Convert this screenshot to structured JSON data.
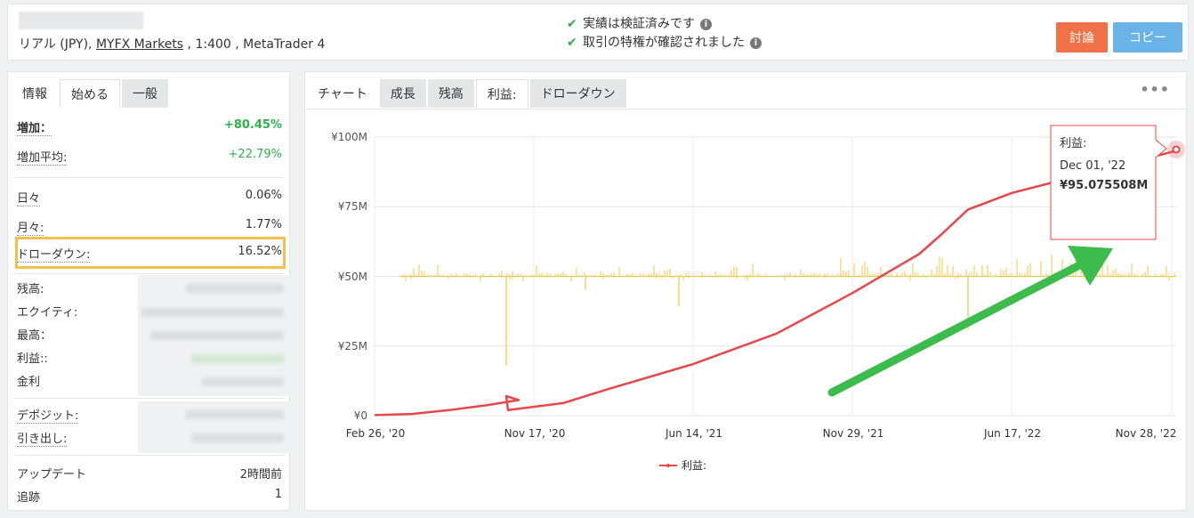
{
  "header": {
    "account_line_prefix": "リアル (JPY), ",
    "broker": "MYFX Markets",
    "account_line_suffix": " , 1:400 , MetaTrader 4",
    "verify1": "実績は検証済みです",
    "verify2": "取引の特権が確認されました",
    "discuss_label": "討論",
    "copy_label": "コピー"
  },
  "left_tabs": [
    "情報",
    "始める",
    "一般"
  ],
  "stats": {
    "gain_label": "増加：",
    "gain_value": "+80.45%",
    "avg_gain_label": "増加平均:",
    "avg_gain_value": "+22.79%",
    "daily_label": "日々",
    "daily_value": "0.06%",
    "monthly_label": "月々:",
    "monthly_value": "1.77%",
    "drawdown_label": "ドローダウン:",
    "drawdown_value": "16.52%",
    "balance_label": "残高:",
    "equity_label": "エクイティ:",
    "highest_label": "最高：",
    "profit_label": "利益::",
    "interest_label": "金利",
    "deposits_label": "デポジット:",
    "withdrawals_label": "引き出し:",
    "updated_label": "アップデート",
    "updated_value": "2時間前",
    "tracking_label": "追跡",
    "tracking_value": "1"
  },
  "right_tabs": [
    "チャート",
    "成長",
    "残高",
    "利益:",
    "ドローダウン"
  ],
  "more_label": "•••",
  "tooltip": {
    "title": "利益:",
    "date": "Dec 01, '22",
    "value": "¥95.075508M"
  },
  "colors": {
    "profit_line": "#e8474a",
    "volume_bars": "#f4c542",
    "arrow": "#3cbc4d",
    "highlight": "#f2c04f"
  },
  "chart_data": {
    "type": "line",
    "y_ticks": [
      "¥100M",
      "¥75M",
      "¥50M",
      "¥25M",
      "¥0"
    ],
    "x_ticks": [
      "Feb 26, '20",
      "Nov 17, '20",
      "Jun 14, '21",
      "Nov 29, '21",
      "Jun 17, '22",
      "Nov 28, '22"
    ],
    "ylim": [
      0,
      100
    ],
    "legend": "利益:",
    "series": [
      {
        "name": "利益:",
        "points": [
          [
            "Feb 26, '20",
            0.2
          ],
          [
            "Apr '20",
            0.6
          ],
          [
            "Jun '20",
            2.1
          ],
          [
            "Aug '20",
            3.8
          ],
          [
            "Oct '20",
            5.6
          ],
          [
            "Nov 10, '20",
            7.0
          ],
          [
            "Nov 17, '20",
            2.0
          ],
          [
            "Jan '21",
            4.5
          ],
          [
            "Mar '21",
            9.5
          ],
          [
            "Jun 14, '21",
            18.5
          ],
          [
            "Sep '21",
            29.5
          ],
          [
            "Nov 29, '21",
            44.0
          ],
          [
            "Feb '22",
            58.0
          ],
          [
            "Mar '22",
            65.0
          ],
          [
            "Apr '22",
            74.0
          ],
          [
            "Jun 17, '22",
            80.0
          ],
          [
            "Dec 01, '22",
            95.08
          ]
        ]
      }
    ]
  }
}
